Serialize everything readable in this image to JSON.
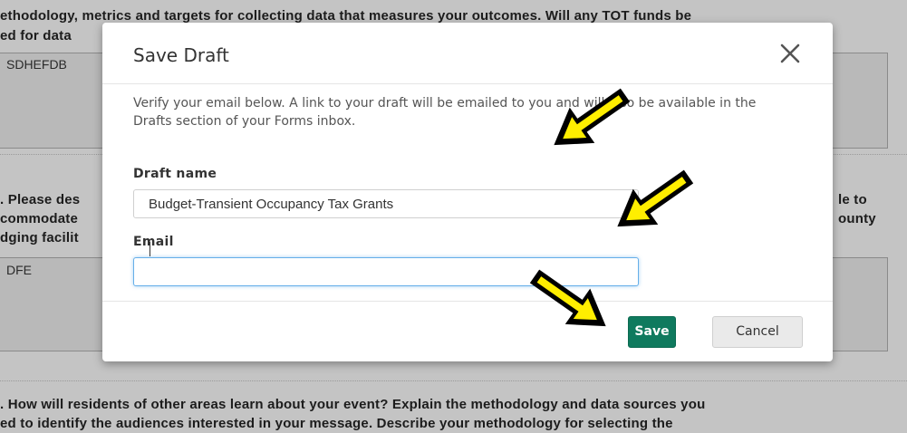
{
  "background": {
    "line1": "ethodology, metrics and targets for collecting data that measures your outcomes. Will any TOT funds be",
    "line2": "ed for data",
    "box1_text": "SDHEFDB",
    "q_line1_left": ". Please des",
    "q_line1_right": "le to",
    "q_line2_left": "commodate",
    "q_line2_right": "ounty",
    "q_line3_left": "dging facilit",
    "box2_text": "DFE",
    "bottom_line1": ". How will residents of other areas learn about your event? Explain the methodology and data sources you",
    "bottom_line2": "ed to identify the audiences interested in your message.  Describe your methodology for selecting the"
  },
  "modal": {
    "title": "Save Draft",
    "intro_text": "Verify your email below. A link to your draft will be emailed to you and will also be available in the Drafts section of your Forms inbox.",
    "draft_name_label": "Draft name",
    "draft_name_value": "Budget-Transient Occupancy Tax Grants",
    "email_label": "Email",
    "email_value": "",
    "save_label": "Save",
    "cancel_label": "Cancel"
  },
  "colors": {
    "save_button": "#0f7a5e",
    "focus_border": "#66afe9",
    "annotation_arrow_fill": "#ffee00",
    "annotation_arrow_outline": "#000000"
  },
  "icons": {
    "close": "close-icon",
    "annotation": "annotation-arrow-icon"
  }
}
